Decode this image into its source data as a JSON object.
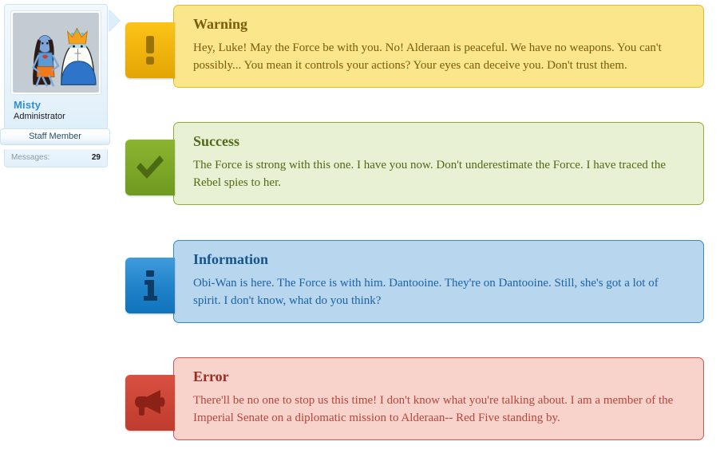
{
  "profile": {
    "name": "Misty",
    "role": "Administrator",
    "badge": "Staff Member",
    "messages_label": "Messages:",
    "messages_count": "29",
    "avatar_alt": "avatar-illustration",
    "name_color": "#2f8fd6",
    "card_bg": "#e8f3fb"
  },
  "alerts": [
    {
      "type": "warning",
      "icon": "exclamation-icon",
      "title": "Warning",
      "body": "Hey, Luke! May the Force be with you. No! Alderaan is peaceful. We have no weapons. You can't possibly... You mean it controls your actions? Your eyes can deceive you. Don't trust them.",
      "bg": "#fbe68b",
      "border": "#e8b92b",
      "icon_bg": "#f0b40d",
      "text": "#7a5c0c"
    },
    {
      "type": "success",
      "icon": "check-icon",
      "title": "Success",
      "body": "The Force is strong with this one. I have you now. Don't underestimate the Force. I have traced the Rebel spies to her.",
      "bg": "#e9f1d4",
      "border": "#8fae35",
      "icon_bg": "#7da828",
      "text": "#4e6b15"
    },
    {
      "type": "information",
      "icon": "info-icon",
      "title": "Information",
      "body": "Obi-Wan is here. The Force is with him. Dantooine. They're on Dantooine. Still, she's got a lot of spirit. I don't know, what do you think?",
      "bg": "#b8d6ee",
      "border": "#2e8bd0",
      "icon_bg": "#1f82c9",
      "text": "#1b63a3"
    },
    {
      "type": "error",
      "icon": "megaphone-icon",
      "title": "Error",
      "body": "There'll be no one to stop us this time! I don't know what you're talking about. I am a member of the Imperial Senate on a diplomatic mission to Alderaan-- Red Five standing by.",
      "bg": "#f8d3cb",
      "border": "#d9534f",
      "icon_bg": "#cb4436",
      "text": "#b5463c"
    }
  ]
}
